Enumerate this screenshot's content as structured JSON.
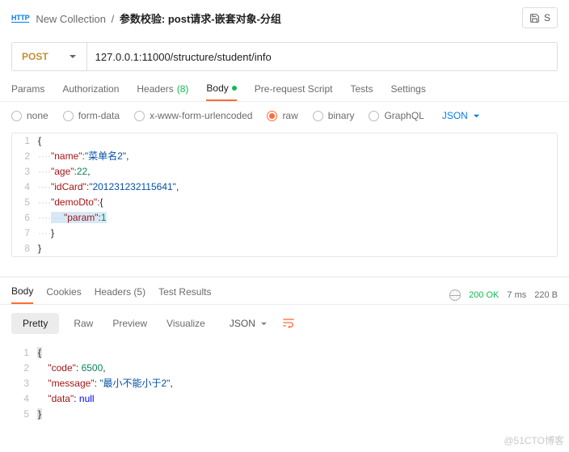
{
  "header": {
    "http_badge": "HTTP",
    "collection": "New Collection",
    "title": "参数校验: post请求-嵌套对象-分组",
    "save_label": "S"
  },
  "url": {
    "method": "POST",
    "value": "127.0.0.1:11000/structure/student/info"
  },
  "tabs": {
    "params": "Params",
    "auth": "Authorization",
    "headers": "Headers",
    "headers_count": "(8)",
    "body": "Body",
    "prereq": "Pre-request Script",
    "tests": "Tests",
    "settings": "Settings"
  },
  "bodytypes": {
    "none": "none",
    "formdata": "form-data",
    "xwww": "x-www-form-urlencoded",
    "raw": "raw",
    "binary": "binary",
    "graphql": "GraphQL",
    "format": "JSON"
  },
  "req_code": {
    "l1": "{",
    "l2_k": "\"name\"",
    "l2_v": "\"菜单名2\"",
    "l3_k": "\"age\"",
    "l3_v": "22",
    "l4_k": "\"idCard\"",
    "l4_v": "\"201231232115641\"",
    "l5_k": "\"demoDto\"",
    "l5_v": "{",
    "l6_k": "\"param\"",
    "l6_v": "1",
    "l7": "}",
    "l8": "}"
  },
  "resp_tabs": {
    "body": "Body",
    "cookies": "Cookies",
    "headers": "Headers",
    "headers_count": "(5)",
    "testres": "Test Results"
  },
  "status": {
    "code": "200 OK",
    "time": "7 ms",
    "size": "220 B"
  },
  "viewbar": {
    "pretty": "Pretty",
    "raw": "Raw",
    "preview": "Preview",
    "visualize": "Visualize",
    "format": "JSON"
  },
  "resp_code": {
    "l1": "{",
    "l2_k": "\"code\"",
    "l2_v": "6500",
    "l3_k": "\"message\"",
    "l3_v": "\"最小不能小于2\"",
    "l4_k": "\"data\"",
    "l4_v": "null",
    "l5": "}"
  },
  "watermark": "@51CTO博客"
}
